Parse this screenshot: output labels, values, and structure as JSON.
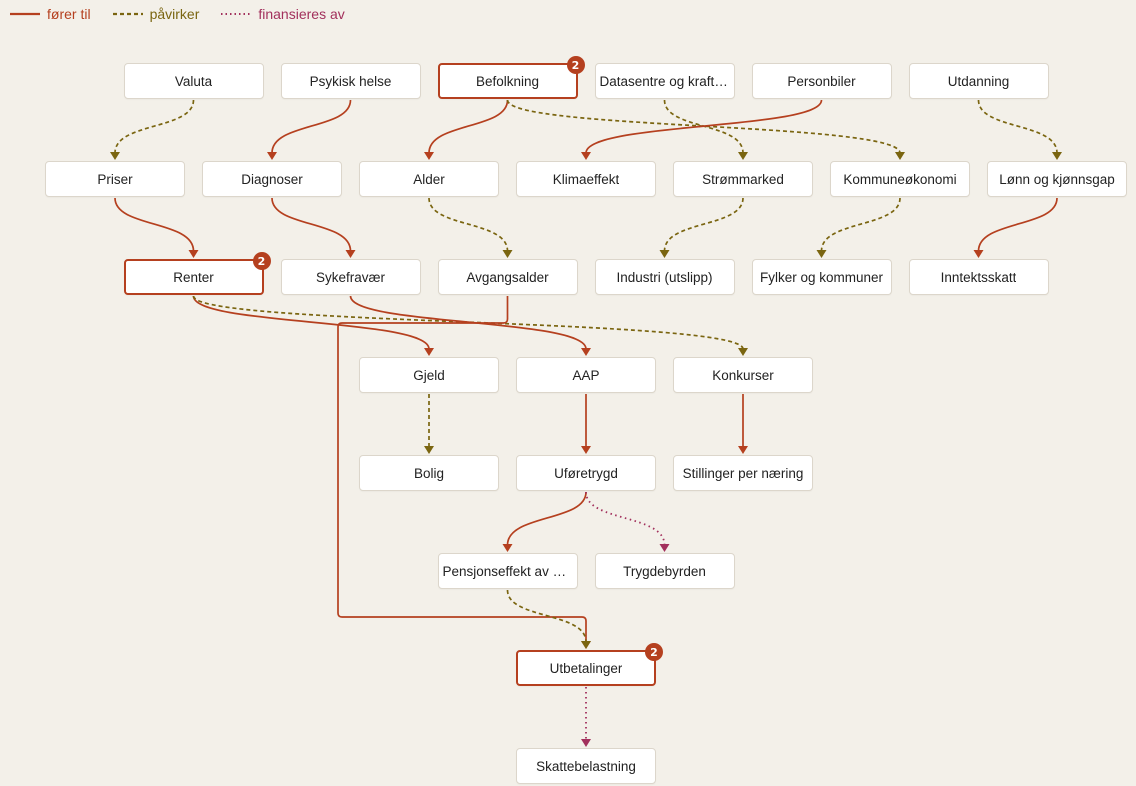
{
  "legend": [
    {
      "label": "fører til",
      "style": "solid",
      "color": "#b5401f"
    },
    {
      "label": "påvirker",
      "style": "dashed",
      "color": "#7a6510"
    },
    {
      "label": "finansieres av",
      "style": "dotted",
      "color": "#a2305c"
    }
  ],
  "colors": {
    "solid": "#b5401f",
    "dashed": "#7a6510",
    "dotted": "#a2305c"
  },
  "nodes": [
    {
      "id": "valuta",
      "label": "Valuta"
    },
    {
      "id": "psykisk",
      "label": "Psykisk helse"
    },
    {
      "id": "befolkning",
      "label": "Befolkning",
      "highlight": true,
      "badge": "2"
    },
    {
      "id": "datasentre",
      "label": "Datasentre og kraftforbruk"
    },
    {
      "id": "personbiler",
      "label": "Personbiler"
    },
    {
      "id": "utdanning",
      "label": "Utdanning"
    },
    {
      "id": "priser",
      "label": "Priser"
    },
    {
      "id": "diagnoser",
      "label": "Diagnoser"
    },
    {
      "id": "alder",
      "label": "Alder"
    },
    {
      "id": "klimaeffekt",
      "label": "Klimaeffekt"
    },
    {
      "id": "strommarked",
      "label": "Strømmarked"
    },
    {
      "id": "kommuneokonomi",
      "label": "Kommuneøkonomi"
    },
    {
      "id": "lonn",
      "label": "Lønn og kjønnsgap"
    },
    {
      "id": "renter",
      "label": "Renter",
      "highlight": true,
      "badge": "2"
    },
    {
      "id": "sykefravaer",
      "label": "Sykefravær"
    },
    {
      "id": "avgangsalder",
      "label": "Avgangsalder"
    },
    {
      "id": "industri",
      "label": "Industri (utslipp)"
    },
    {
      "id": "fylker",
      "label": "Fylker og kommuner"
    },
    {
      "id": "inntektsskatt",
      "label": "Inntektsskatt"
    },
    {
      "id": "gjeld",
      "label": "Gjeld"
    },
    {
      "id": "aap",
      "label": "AAP"
    },
    {
      "id": "konkurser",
      "label": "Konkurser"
    },
    {
      "id": "bolig",
      "label": "Bolig"
    },
    {
      "id": "uforetrygd",
      "label": "Uføretrygd"
    },
    {
      "id": "stillinger",
      "label": "Stillinger per næring"
    },
    {
      "id": "pensjonseffekt",
      "label": "Pensjonseffekt av uføretrygd"
    },
    {
      "id": "trygdebyrden",
      "label": "Trygdebyrden"
    },
    {
      "id": "utbetalinger",
      "label": "Utbetalinger",
      "highlight": true,
      "badge": "2"
    },
    {
      "id": "skattebelastning",
      "label": "Skattebelastning"
    }
  ],
  "edges": [
    {
      "from": "valuta",
      "to": "priser",
      "type": "dashed"
    },
    {
      "from": "psykisk",
      "to": "diagnoser",
      "type": "solid"
    },
    {
      "from": "befolkning",
      "to": "alder",
      "type": "solid"
    },
    {
      "from": "befolkning",
      "to": "kommuneokonomi",
      "type": "dashed"
    },
    {
      "from": "datasentre",
      "to": "strommarked",
      "type": "dashed"
    },
    {
      "from": "personbiler",
      "to": "klimaeffekt",
      "type": "solid"
    },
    {
      "from": "utdanning",
      "to": "lonn",
      "type": "dashed"
    },
    {
      "from": "priser",
      "to": "renter",
      "type": "solid"
    },
    {
      "from": "diagnoser",
      "to": "sykefravaer",
      "type": "solid"
    },
    {
      "from": "alder",
      "to": "avgangsalder",
      "type": "dashed"
    },
    {
      "from": "strommarked",
      "to": "industri",
      "type": "dashed"
    },
    {
      "from": "kommuneokonomi",
      "to": "fylker",
      "type": "dashed"
    },
    {
      "from": "lonn",
      "to": "inntektsskatt",
      "type": "solid"
    },
    {
      "from": "renter",
      "to": "gjeld",
      "type": "solid"
    },
    {
      "from": "renter",
      "to": "konkurser",
      "type": "dashed"
    },
    {
      "from": "sykefravaer",
      "to": "aap",
      "type": "solid"
    },
    {
      "from": "avgangsalder",
      "to": "utbetalinger",
      "type": "solid",
      "route": "detour"
    },
    {
      "from": "gjeld",
      "to": "bolig",
      "type": "dashed"
    },
    {
      "from": "aap",
      "to": "uforetrygd",
      "type": "solid"
    },
    {
      "from": "konkurser",
      "to": "stillinger",
      "type": "solid"
    },
    {
      "from": "uforetrygd",
      "to": "pensjonseffekt",
      "type": "solid"
    },
    {
      "from": "uforetrygd",
      "to": "trygdebyrden",
      "type": "dotted"
    },
    {
      "from": "pensjonseffekt",
      "to": "utbetalinger",
      "type": "dashed"
    },
    {
      "from": "utbetalinger",
      "to": "skattebelastning",
      "type": "dotted"
    }
  ]
}
